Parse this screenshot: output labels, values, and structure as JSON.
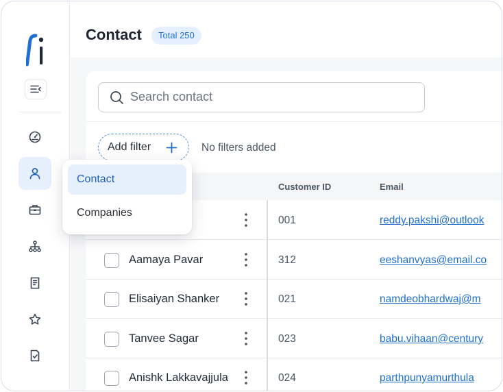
{
  "header": {
    "title": "Contact",
    "total_badge": "Total 250"
  },
  "search": {
    "placeholder": "Search contact"
  },
  "filters": {
    "add_filter_label": "Add filter",
    "status": "No filters added"
  },
  "dropdown": {
    "items": [
      "Contact",
      "Companies"
    ],
    "selected": "Contact"
  },
  "table": {
    "columns": [
      "Customer ID",
      "Email"
    ],
    "rows": [
      {
        "name": "",
        "customer_id": "001",
        "email": "reddy.pakshi@outlook"
      },
      {
        "name": "Aamaya Pavar",
        "customer_id": "312",
        "email": "eeshanvyas@email.co"
      },
      {
        "name": "Elisaiyan Shanker",
        "customer_id": "021",
        "email": "namdeobhardwaj@m"
      },
      {
        "name": "Tanvee Sagar",
        "customer_id": "023",
        "email": "babu.vihaan@century"
      },
      {
        "name": "Anishk Lakkavajjula",
        "customer_id": "024",
        "email": "parthpunyamurthula"
      }
    ]
  },
  "sidebar": {
    "items": [
      "dashboard-icon",
      "contact-icon",
      "briefcase-icon",
      "org-chart-icon",
      "document-icon",
      "star-icon",
      "task-icon"
    ],
    "active": "contact-icon"
  },
  "colors": {
    "accent": "#1f6fd1",
    "badge_bg": "#e4efff",
    "selected_bg": "#e6f0fc"
  }
}
